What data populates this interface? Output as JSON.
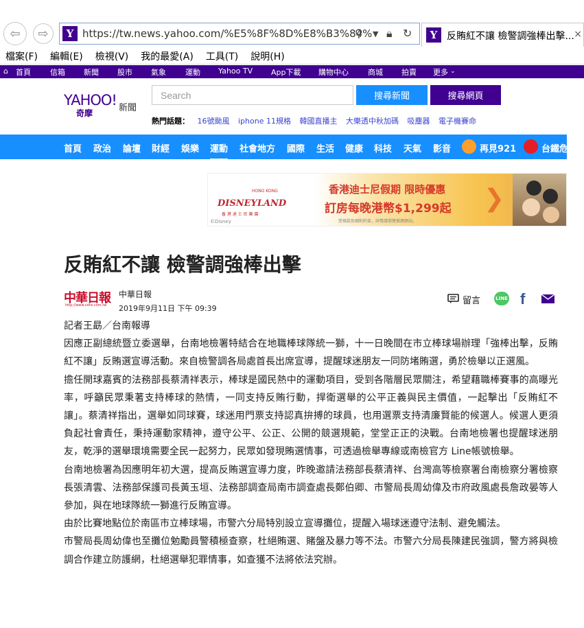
{
  "browser": {
    "url": "https://tw.news.yahoo.com/%E5%8F%8D%E8%B3%84%",
    "tab_title": "反賄紅不讓 檢警調強棒出擊...",
    "tab_close": "×",
    "menu": [
      "檔案(F)",
      "編輯(E)",
      "檢視(V)",
      "我的最愛(A)",
      "工具(T)",
      "說明(H)"
    ]
  },
  "yahoo_topbar": {
    "items": [
      "首頁",
      "信箱",
      "新聞",
      "股市",
      "氣象",
      "運動",
      "Yahoo TV",
      "App下載",
      "購物中心",
      "商城",
      "拍賣",
      "更多"
    ]
  },
  "header": {
    "logo_main": "YAHOO!",
    "logo_sub": "奇摩",
    "logo_news": "新聞",
    "search_placeholder": "Search",
    "search_news_label": "搜尋新聞",
    "search_web_label": "搜尋網頁",
    "hot_label": "熱門話題：",
    "hot_topics": [
      "16號颱風",
      "iphone 11規格",
      "韓國直播主",
      "大樂透中秋加碼",
      "吸塵器",
      "電子機賽命"
    ]
  },
  "category_nav": {
    "items": [
      "首頁",
      "政治",
      "論壇",
      "財經",
      "娛樂",
      "運動",
      "社會地方",
      "國際",
      "生活",
      "健康",
      "科技",
      "天氣",
      "影音",
      "再見921",
      "台鐵危"
    ],
    "active": "運動"
  },
  "ad": {
    "brand": "DISNEYLAND",
    "brand_top": "HONG KONG",
    "brand_sub": "香 港 迪 士 尼 樂 園",
    "title1": "香港迪士尼假期 限時優惠",
    "title2": "訂房每晚港幣$1,299起",
    "fine_print": "受條款及細則約束，詳情請瀏覽推廣網站。",
    "copyright": "©Disney"
  },
  "article": {
    "title": "反賄紅不讓 檢警調強棒出擊",
    "publisher_logo": "中華日報",
    "publisher_logo_url": "http://www.cdns.com.tw",
    "publisher": "中華日報",
    "date": "2019年9月11日 下午 09:39",
    "comment_label": "留言",
    "line_label": "LINE",
    "paragraphs": [
      "記者王勗／台南報導",
      "因應正副總統暨立委選舉，台南地檢署特結合在地職棒球隊統一獅，十一日晚間在市立棒球場辦理「強棒出擊，反賄紅不讓」反賄選宣導活動。來自檢警調各局處首長出席宣導，提醒球迷朋友一同防堵賄選，勇於檢舉以正選風。",
      "擔任開球嘉賓的法務部長蔡清祥表示，棒球是國民熱中的運動項目，受到各階層民眾關注，希望藉職棒賽事的高曝光率，呼籲民眾秉著支持棒球的熱情，一同支持反賄行動，捍衛選舉的公平正義與民主價值，一起擊出「反賄紅不讓」。蔡清祥指出，選舉如同球賽，球迷用門票支持認真拚搏的球員，也用選票支持清廉賢能的候選人。候選人更須負起社會責任，秉持運動家精神，遵守公平、公正、公開的競選規範，堂堂正正的決戰。台南地檢署也提醒球迷朋友，乾淨的選舉環境需要全民一起努力，民眾如發現賄選情事，可透過檢舉專線或南檢官方 Line帳號檢舉。",
      "台南地檢署為因應明年初大選，提高反賄選宣導力度，昨晚邀請法務部長蔡清祥、台灣高等檢察署台南檢察分署檢察長張清雲、法務部保護司長黃玉垣、法務部調查局南市調查處長鄭伯卿、市警局長周幼偉及市府政風處長詹政晏等人參加，與在地球隊統一獅進行反賄宣導。",
      "由於比賽地點位於南區市立棒球場，市警六分局特別設立宣導攤位，提醒入場球迷遵守法制、避免觸法。",
      "市警局長周幼偉也至攤位勉勵員警積極查察，杜絕賄選、賭盤及暴力等不法。市警六分局長陳建民強調，警方將與檢調合作建立防護網，杜絕選舉犯罪情事，如查獲不法將依法究辦。"
    ]
  }
}
